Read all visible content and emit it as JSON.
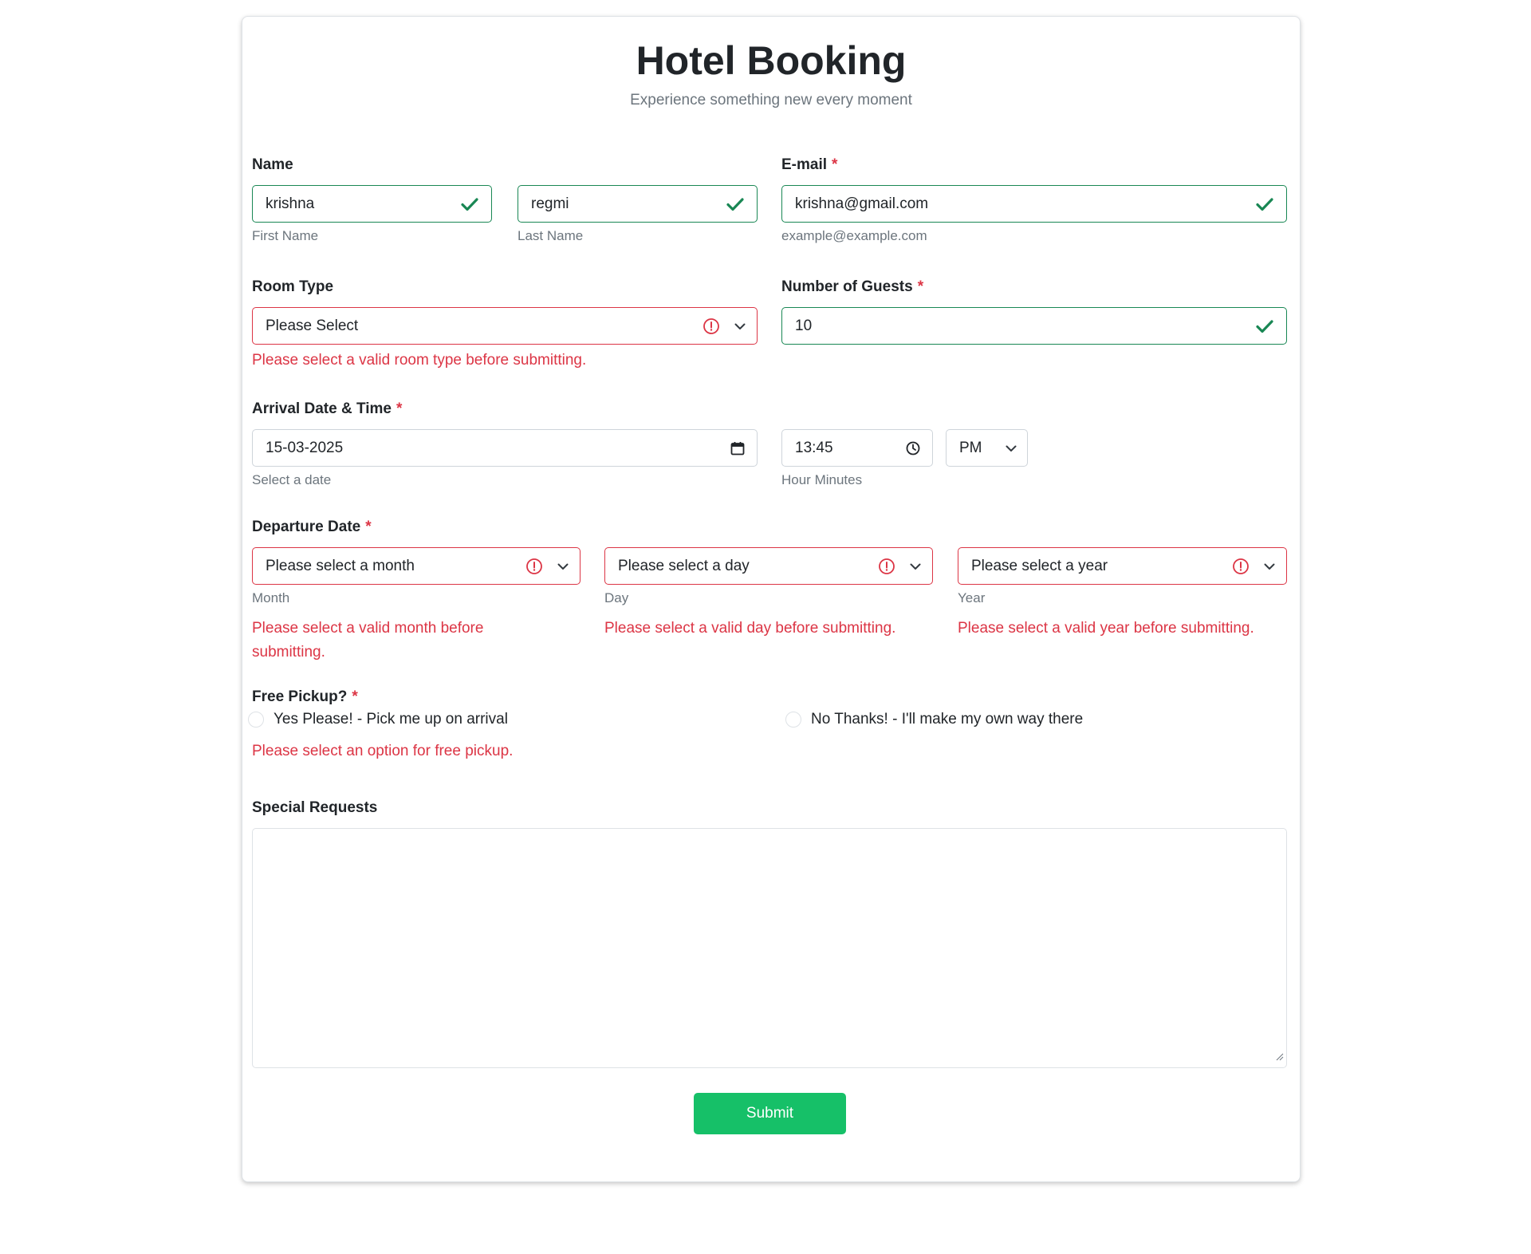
{
  "header": {
    "title": "Hotel Booking",
    "subtitle": "Experience something new every moment"
  },
  "name": {
    "label": "Name",
    "first_value": "krishna",
    "first_help": "First Name",
    "last_value": "regmi",
    "last_help": "Last Name"
  },
  "email": {
    "label": "E-mail",
    "required_mark": "*",
    "value": "krishna@gmail.com",
    "help": "example@example.com"
  },
  "room_type": {
    "label": "Room Type",
    "selected": "Please Select",
    "error": "Please select a valid room type before submitting."
  },
  "guests": {
    "label": "Number of Guests",
    "required_mark": "*",
    "value": "10"
  },
  "arrival": {
    "label": "Arrival Date & Time",
    "required_mark": "*",
    "date_value": "15-03-2025",
    "date_help": "Select a date",
    "time_value": "13:45",
    "time_help": "Hour Minutes",
    "ampm_selected": "PM"
  },
  "departure": {
    "label": "Departure Date",
    "required_mark": "*",
    "month_selected": "Please select a month",
    "month_help": "Month",
    "month_error": "Please select a valid month before submitting.",
    "day_selected": "Please select a day",
    "day_help": "Day",
    "day_error": "Please select a valid day before submitting.",
    "year_selected": "Please select a year",
    "year_help": "Year",
    "year_error": "Please select a valid year before submitting."
  },
  "pickup": {
    "label": "Free Pickup?",
    "required_mark": "*",
    "option_yes": "Yes Please! - Pick me up on arrival",
    "option_no": "No Thanks! - I'll make my own way there",
    "error": "Please select an option for free pickup."
  },
  "special_requests": {
    "label": "Special Requests",
    "value": ""
  },
  "submit_label": "Submit",
  "colors": {
    "valid": "#198754",
    "invalid": "#dc3545",
    "submit": "#16c068",
    "muted": "#6c757d"
  },
  "icons": {
    "valid": "check-icon",
    "invalid": "exclamation-circle-icon",
    "select": "chevron-down-icon",
    "date": "calendar-icon",
    "time": "clock-icon"
  }
}
